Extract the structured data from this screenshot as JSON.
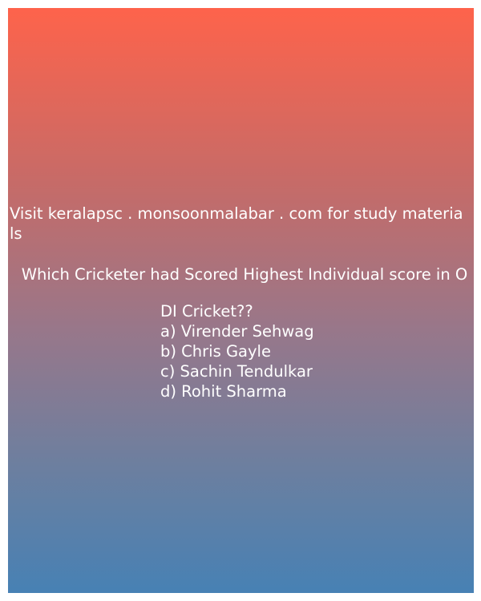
{
  "header": {
    "line1": "Visit keralapsc . monsoonmalabar . com for study materia",
    "line2": "ls"
  },
  "question": {
    "line1": "Which Cricketer had Scored Highest Individual score in O",
    "line2": "DI Cricket??"
  },
  "options": [
    "a) Virender Sehwag",
    "b) Chris Gayle",
    "c) Sachin Tendulkar",
    "d) Rohit Sharma"
  ],
  "colors": {
    "gradient_top": "#fe634b",
    "gradient_bottom": "#4781b4",
    "text": "#ffffff"
  }
}
